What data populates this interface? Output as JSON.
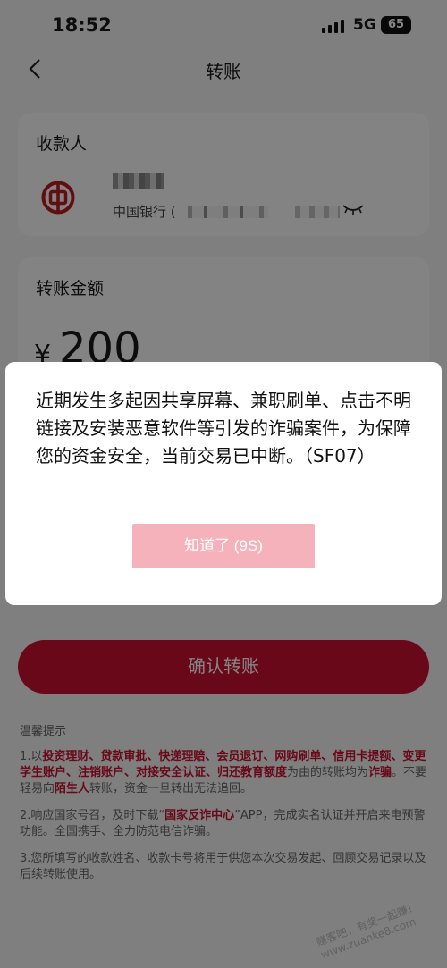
{
  "status_bar": {
    "time": "18:52",
    "network": "5G",
    "battery": "65"
  },
  "nav": {
    "title": "转账"
  },
  "payee": {
    "section_title": "收款人",
    "bank_name": "中国银行 ("
  },
  "amount": {
    "section_title": "转账金额",
    "currency": "¥",
    "value": "200"
  },
  "confirm_button": "确认转账",
  "tips": {
    "title": "温馨提示",
    "tip1": [
      {
        "t": "1.以",
        "hl": false
      },
      {
        "t": "投资理财、贷款审批、快递理赔、会员退订、网购刷单、信用卡提额、变更学生账户、注销账户、对接安全认证、归还教育额度",
        "hl": true
      },
      {
        "t": "为由的转账均为",
        "hl": false
      },
      {
        "t": "诈骗",
        "hl": true
      },
      {
        "t": "。不要轻易向",
        "hl": false
      },
      {
        "t": "陌生人",
        "hl": true
      },
      {
        "t": "转账，资金一旦转出无法追回。",
        "hl": false
      }
    ],
    "tip2": [
      {
        "t": "2.响应国家号召，及时下载“",
        "hl": false
      },
      {
        "t": "国家反诈中心",
        "hl": true
      },
      {
        "t": "”APP，完成实名认证并开启来电预警功能。全国携手、全力防范电信诈骗。",
        "hl": false
      }
    ],
    "tip3": "3.您所填写的收款姓名、收款卡号将用于供您本次交易发起、回顾交易记录以及后续转账使用。"
  },
  "watermark": "赚客吧，有奖一起赚！www.zuanke8.com",
  "dialog": {
    "message": "近期发生多起因共享屏幕、兼职刷单、点击不明链接及安装恶意软件等引发的诈骗案件，为保障您的资金安全，当前交易已中断。（SF07）",
    "button": "知道了 (9S)"
  },
  "colors": {
    "brand_red": "#c8102e",
    "disabled_button": "#f5b2ba"
  }
}
